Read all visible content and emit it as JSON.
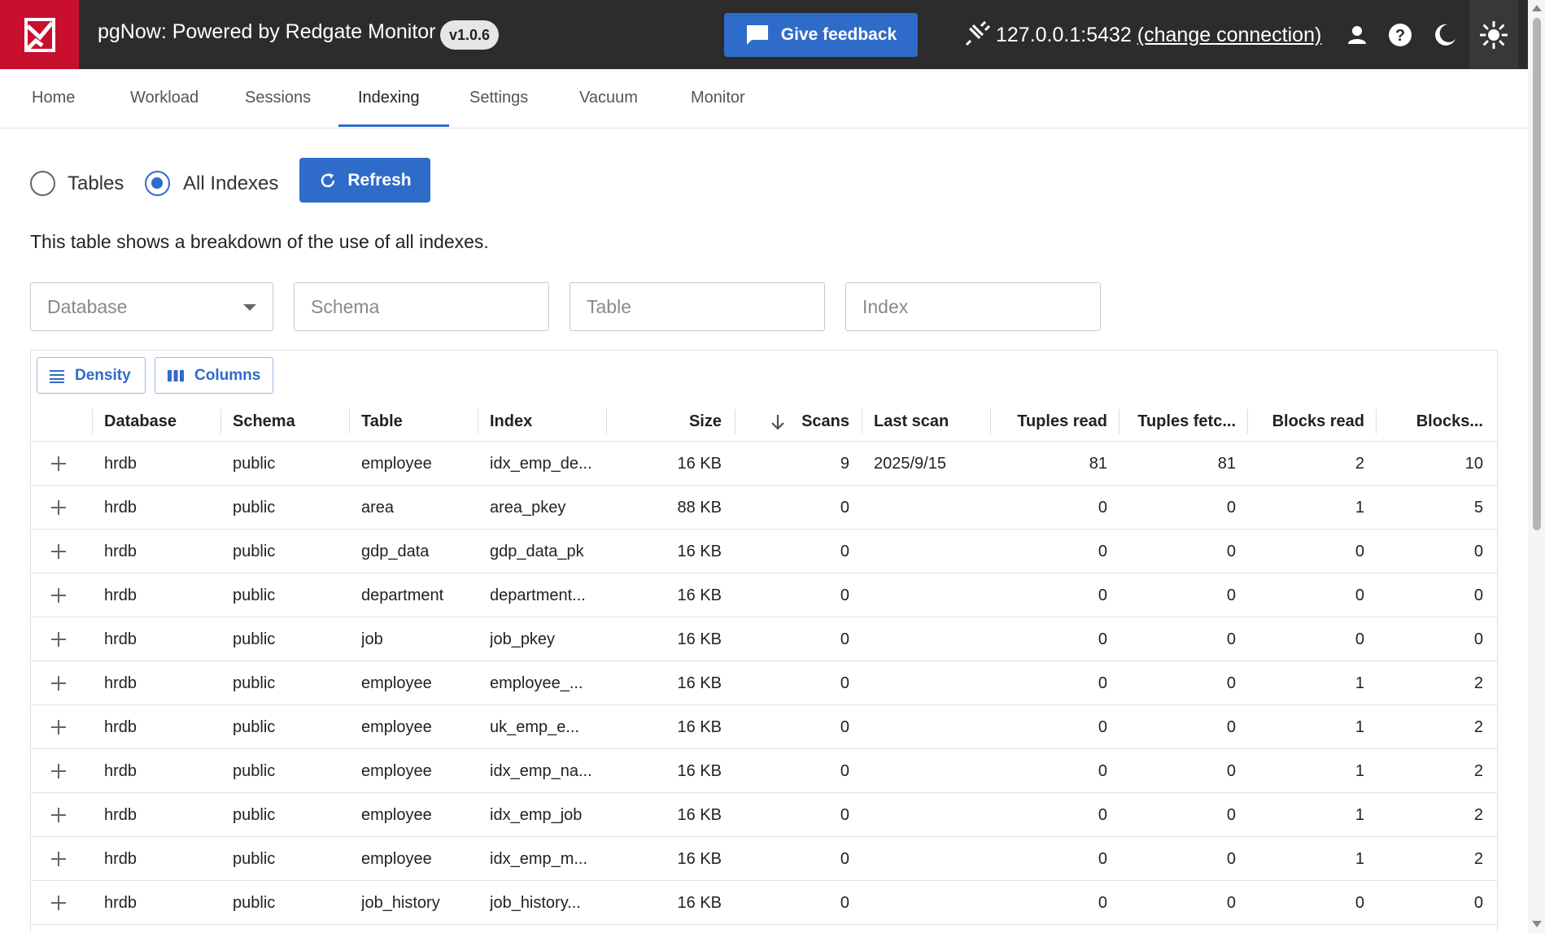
{
  "header": {
    "app_title": "pgNow: Powered by Redgate Monitor",
    "version": "v1.0.6",
    "feedback_label": "Give feedback",
    "connection_host": "127.0.0.1:5432",
    "connection_change": "(change connection)",
    "icons": [
      "logo-icon",
      "feedback-icon",
      "plug-icon",
      "user-icon",
      "help-icon",
      "dark-mode-icon",
      "light-mode-icon"
    ]
  },
  "tabs": [
    {
      "label": "Home",
      "active": false
    },
    {
      "label": "Workload",
      "active": false
    },
    {
      "label": "Sessions",
      "active": false
    },
    {
      "label": "Indexing",
      "active": true
    },
    {
      "label": "Settings",
      "active": false
    },
    {
      "label": "Vacuum",
      "active": false
    },
    {
      "label": "Monitor",
      "active": false
    }
  ],
  "controls": {
    "radio_tables": "Tables",
    "radio_all_indexes": "All Indexes",
    "selected": "All Indexes",
    "refresh_label": "Refresh",
    "description": "This table shows a breakdown of the use of all indexes."
  },
  "filters": {
    "database_placeholder": "Database",
    "schema_placeholder": "Schema",
    "table_placeholder": "Table",
    "index_placeholder": "Index"
  },
  "toolbar": {
    "density_label": "Density",
    "columns_label": "Columns"
  },
  "columns": [
    "Database",
    "Schema",
    "Table",
    "Index",
    "Size",
    "Scans",
    "Last scan",
    "Tuples read",
    "Tuples fetc...",
    "Blocks read",
    "Blocks..."
  ],
  "sort": {
    "column": "Scans",
    "direction": "descending"
  },
  "rows": [
    [
      "hrdb",
      "public",
      "employee",
      "idx_emp_de...",
      "16 KB",
      "9",
      "2025/9/15",
      "81",
      "81",
      "2",
      "10"
    ],
    [
      "hrdb",
      "public",
      "area",
      "area_pkey",
      "88 KB",
      "0",
      "",
      "0",
      "0",
      "1",
      "5"
    ],
    [
      "hrdb",
      "public",
      "gdp_data",
      "gdp_data_pk",
      "16 KB",
      "0",
      "",
      "0",
      "0",
      "0",
      "0"
    ],
    [
      "hrdb",
      "public",
      "department",
      "department...",
      "16 KB",
      "0",
      "",
      "0",
      "0",
      "0",
      "0"
    ],
    [
      "hrdb",
      "public",
      "job",
      "job_pkey",
      "16 KB",
      "0",
      "",
      "0",
      "0",
      "0",
      "0"
    ],
    [
      "hrdb",
      "public",
      "employee",
      "employee_...",
      "16 KB",
      "0",
      "",
      "0",
      "0",
      "1",
      "2"
    ],
    [
      "hrdb",
      "public",
      "employee",
      "uk_emp_e...",
      "16 KB",
      "0",
      "",
      "0",
      "0",
      "1",
      "2"
    ],
    [
      "hrdb",
      "public",
      "employee",
      "idx_emp_na...",
      "16 KB",
      "0",
      "",
      "0",
      "0",
      "1",
      "2"
    ],
    [
      "hrdb",
      "public",
      "employee",
      "idx_emp_job",
      "16 KB",
      "0",
      "",
      "0",
      "0",
      "1",
      "2"
    ],
    [
      "hrdb",
      "public",
      "employee",
      "idx_emp_m...",
      "16 KB",
      "0",
      "",
      "0",
      "0",
      "1",
      "2"
    ],
    [
      "hrdb",
      "public",
      "job_history",
      "job_history...",
      "16 KB",
      "0",
      "",
      "0",
      "0",
      "0",
      "0"
    ]
  ],
  "colors": {
    "header_bg": "#2c2c2c",
    "logo_bg": "#c8102e",
    "accent": "#2f6cc9"
  }
}
